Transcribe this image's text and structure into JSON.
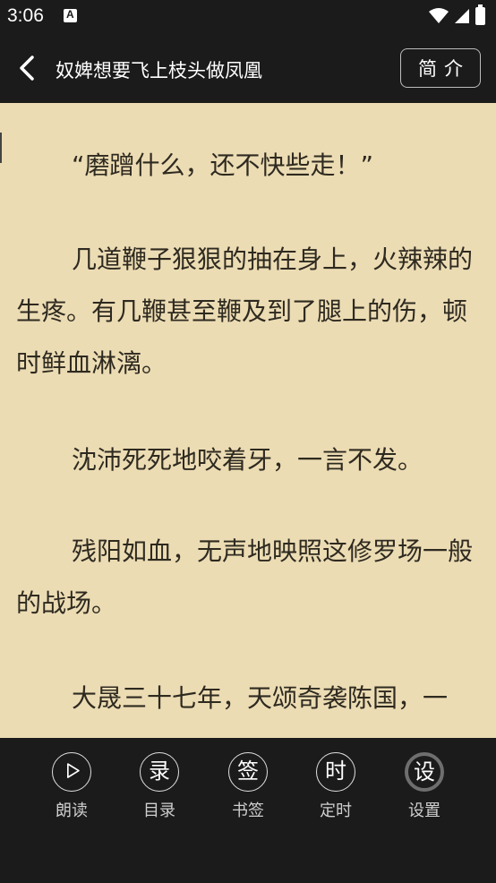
{
  "status_bar": {
    "time": "3:06",
    "notification_icon": "text-a-icon",
    "wifi_icon": "wifi-icon",
    "signal_icon": "cell-signal-icon",
    "battery_icon": "battery-icon"
  },
  "toolbar": {
    "back_icon": "chevron-left-icon",
    "title": "奴婢想要飞上枝头做凤凰",
    "intro_label": "简介"
  },
  "reader": {
    "paragraphs": [
      "“磨蹭什么，还不快些走！”",
      "几道鞭子狠狠的抽在身上，火辣辣的生疼。有几鞭甚至鞭及到了腿上的伤，顿时鲜血淋漓。",
      "沈沛死死地咬着牙，一言不发。",
      "残阳如血，无声地映照这修罗场一般的战场。",
      "大晟三十七年，天颂奇袭陈国，一"
    ],
    "background_color": "#ecdcb4",
    "text_color": "#2e2a20"
  },
  "bottom_tools": [
    {
      "glyph": "",
      "icon": "play-icon",
      "label": "朗读"
    },
    {
      "glyph": "录",
      "icon": "catalog-icon",
      "label": "目录"
    },
    {
      "glyph": "签",
      "icon": "bookmark-icon",
      "label": "书签"
    },
    {
      "glyph": "时",
      "icon": "timer-icon",
      "label": "定时"
    },
    {
      "glyph": "设",
      "icon": "settings-icon",
      "label": "设置"
    }
  ]
}
